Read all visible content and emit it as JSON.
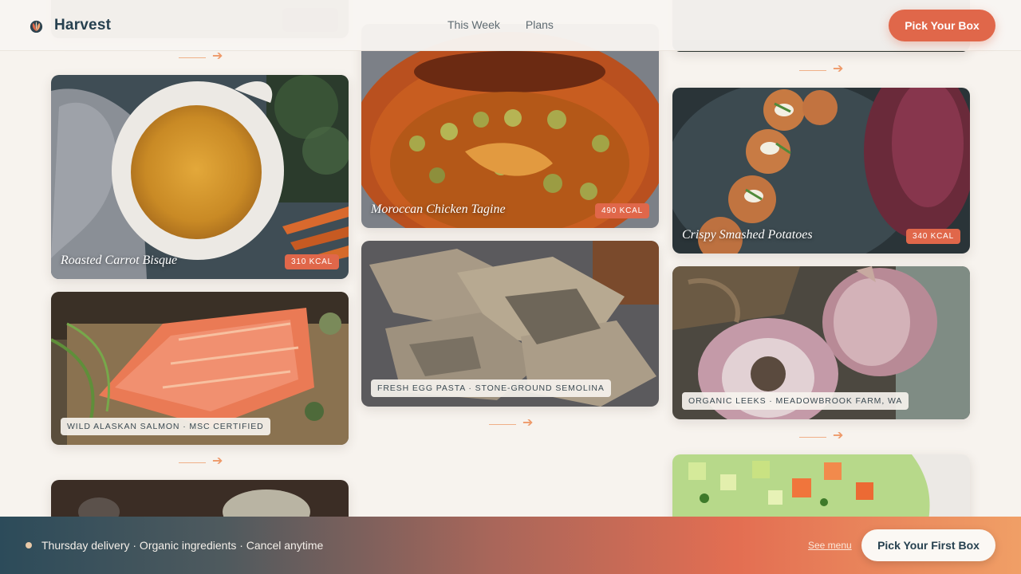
{
  "header": {
    "brand": "Harvest",
    "nav": [
      "This Week",
      "Plans"
    ],
    "cta": "Pick Your Box"
  },
  "cards": {
    "carrot_bisque": {
      "title": "Roasted Carrot Bisque",
      "kcal": "310 KCAL"
    },
    "salmon": {
      "tag": "WILD ALASKAN SALMON · MSC CERTIFIED"
    },
    "tagine": {
      "title": "Moroccan Chicken Tagine",
      "kcal": "490 KCAL"
    },
    "pasta": {
      "tag": "FRESH EGG PASTA · STONE-GROUND SEMOLINA"
    },
    "potatoes": {
      "title": "Crispy Smashed Potatoes",
      "kcal": "340 KCAL"
    },
    "garlic": {
      "tag": "ORGANIC LEEKS · MEADOWBROOK FARM, WA"
    }
  },
  "bottom_bar": {
    "text": "Thursday delivery · Organic ingredients · Cancel anytime",
    "see_menu": "See menu",
    "cta": "Pick Your First Box"
  },
  "colors": {
    "accent": "#e0674a",
    "background": "#f7f3ee",
    "brand_text": "#26404f"
  },
  "icons": [
    "harvest-logo-icon",
    "arrow-right-icon"
  ]
}
